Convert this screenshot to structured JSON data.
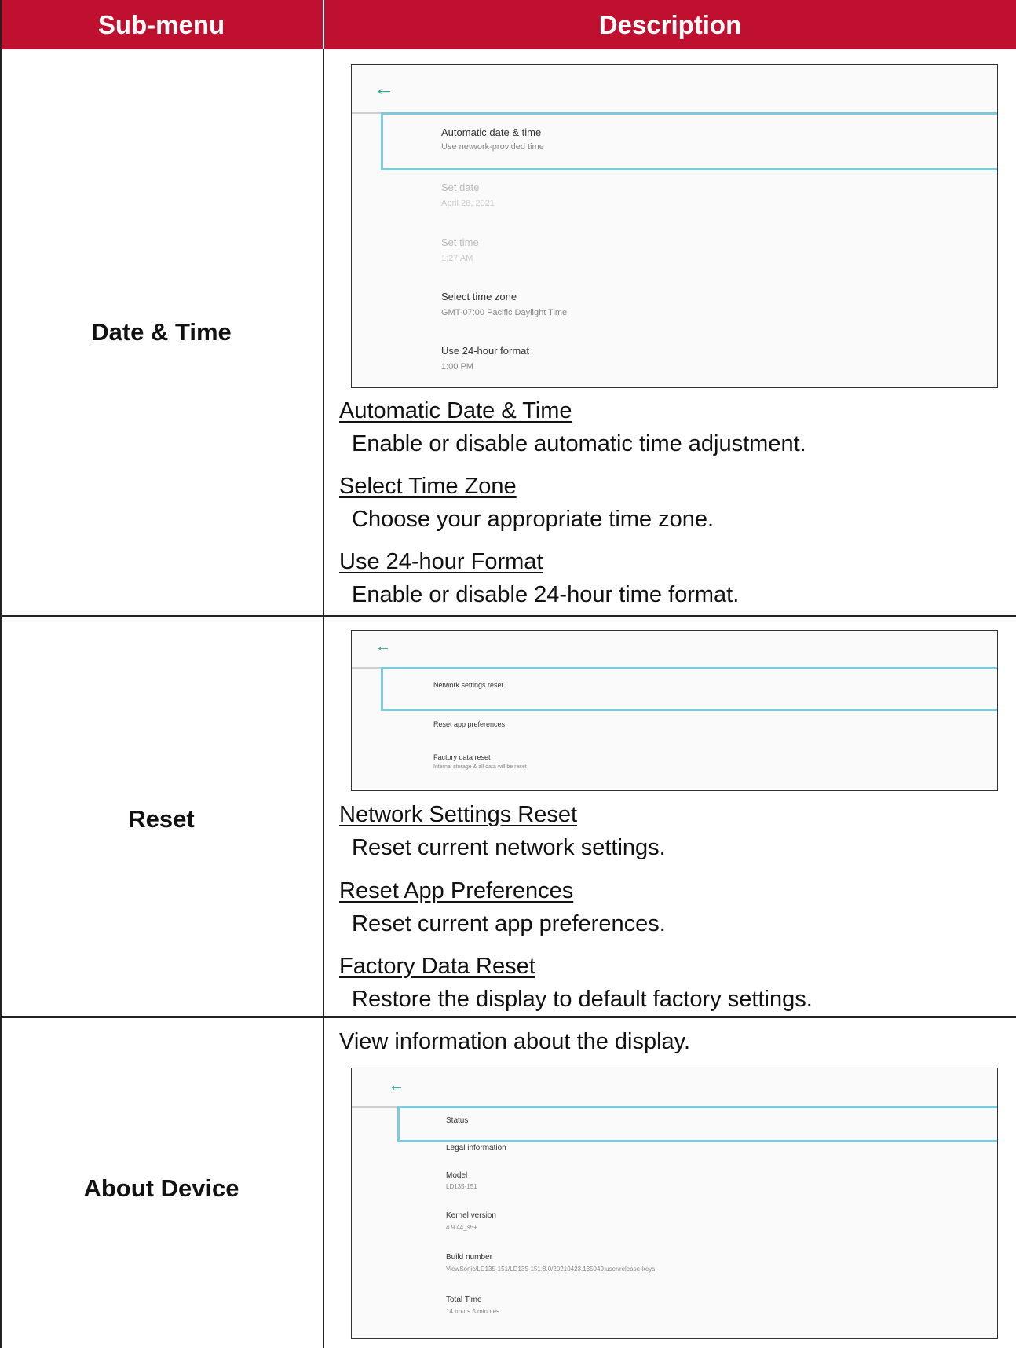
{
  "header": {
    "submenu": "Sub-menu",
    "description": "Description"
  },
  "rows": {
    "date_time": {
      "label": "Date & Time",
      "screen": {
        "items": [
          {
            "title": "Automatic date & time",
            "subtitle": "Use network-provided time"
          },
          {
            "title": "Set date",
            "subtitle": "April 28, 2021"
          },
          {
            "title": "Set time",
            "subtitle": "1:27 AM"
          },
          {
            "title": "Select time zone",
            "subtitle": "GMT-07:00 Pacific Daylight Time"
          },
          {
            "title": "Use 24-hour format",
            "subtitle": "1:00 PM"
          }
        ]
      },
      "items": [
        {
          "title": "Automatic Date & Time",
          "desc": "Enable or disable automatic time adjustment."
        },
        {
          "title": "Select Time Zone",
          "desc": "Choose your appropriate time zone."
        },
        {
          "title": "Use 24-hour Format",
          "desc": "Enable or disable 24-hour time format."
        }
      ]
    },
    "reset": {
      "label": "Reset",
      "screen": {
        "items": [
          {
            "title": "Network settings reset",
            "subtitle": ""
          },
          {
            "title": "Reset app preferences",
            "subtitle": ""
          },
          {
            "title": "Factory data reset",
            "subtitle": "Internal storage & all data will be reset"
          }
        ]
      },
      "items": [
        {
          "title": "Network Settings Reset",
          "desc": "Reset current network settings."
        },
        {
          "title": "Reset App Preferences",
          "desc": "Reset current app preferences."
        },
        {
          "title": "Factory Data Reset",
          "desc": "Restore the display to default factory settings."
        }
      ]
    },
    "about": {
      "label": "About Device",
      "intro": "View information about the display.",
      "screen": {
        "items": [
          {
            "title": "Status",
            "subtitle": ""
          },
          {
            "title": "Legal information",
            "subtitle": ""
          },
          {
            "title": "Model",
            "subtitle": "LD135-151"
          },
          {
            "title": "Kernel version",
            "subtitle": "4.9.44_s5+"
          },
          {
            "title": "Build number",
            "subtitle": "ViewSonic/LD135-151/LD135-151:8.0/20210423.135049:user/release-keys"
          },
          {
            "title": "Total Time",
            "subtitle": "14 hours 5 minutes"
          }
        ]
      }
    }
  },
  "colors": {
    "header_bg": "#c0102f",
    "back_arrow": "#26a69a",
    "focus_border": "#7cc9e0"
  },
  "icons": {
    "back": "back-arrow-icon"
  }
}
